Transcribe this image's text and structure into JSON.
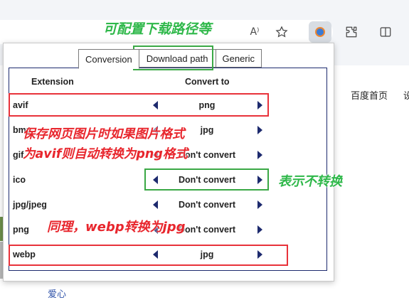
{
  "browser": {
    "read_aloud_label": "A⁾",
    "favorite_icon": "star-outline-icon",
    "extension_icon": "extension-badge-icon",
    "puzzle_icon": "puzzle-icon",
    "split_icon": "split-screen-icon"
  },
  "page": {
    "link_home": "百度首页",
    "link_cut": "设",
    "bottom_link": "爱心"
  },
  "popup": {
    "tabs": [
      {
        "label": "Conversion",
        "active": true
      },
      {
        "label": "Download path",
        "active": false
      },
      {
        "label": "Generic",
        "active": false
      }
    ],
    "headers": {
      "extension": "Extension",
      "convert_to": "Convert to"
    },
    "rows": [
      {
        "ext": "avif",
        "value": "png"
      },
      {
        "ext": "bmp",
        "value": "jpg"
      },
      {
        "ext": "gif",
        "value": "Don't convert"
      },
      {
        "ext": "ico",
        "value": "Don't convert"
      },
      {
        "ext": "jpg/jpeg",
        "value": "Don't convert"
      },
      {
        "ext": "png",
        "value": "Don't convert"
      },
      {
        "ext": "webp",
        "value": "jpg"
      }
    ]
  },
  "annotations": {
    "download_path_note": "可配置下载路径等",
    "avif_note_line1": "保存网页图片时如果图片格式",
    "avif_note_line2": "为avif则自动转换为png格式",
    "dont_convert_note": "表示不转换",
    "webp_note": "同理，webp转换为jpg"
  },
  "colors": {
    "red_box": "#e8323a",
    "green_box": "#3aa845",
    "arrow": "#1d2a6e"
  }
}
